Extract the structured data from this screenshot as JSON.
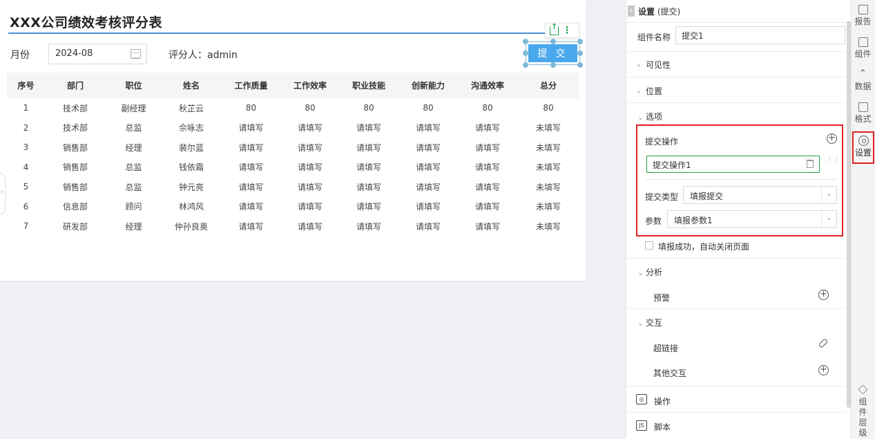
{
  "report": {
    "title": "XXX公司绩效考核评分表",
    "month_label": "月份",
    "month_value": "2024-08",
    "rater_text": "评分人：admin",
    "submit_label": "提 交",
    "columns": [
      "序号",
      "部门",
      "职位",
      "姓名",
      "工作质量",
      "工作效率",
      "职业技能",
      "创新能力",
      "沟通效率",
      "总分"
    ],
    "rows": [
      [
        "1",
        "技术部",
        "副经理",
        "秋芷云",
        "80",
        "80",
        "80",
        "80",
        "80",
        "80"
      ],
      [
        "2",
        "技术部",
        "总监",
        "佘咏志",
        "请填写",
        "请填写",
        "请填写",
        "请填写",
        "请填写",
        "未填写"
      ],
      [
        "3",
        "销售部",
        "经理",
        "裴尔蓝",
        "请填写",
        "请填写",
        "请填写",
        "请填写",
        "请填写",
        "未填写"
      ],
      [
        "4",
        "销售部",
        "总监",
        "钱依霜",
        "请填写",
        "请填写",
        "请填写",
        "请填写",
        "请填写",
        "未填写"
      ],
      [
        "5",
        "销售部",
        "总监",
        "钟元亮",
        "请填写",
        "请填写",
        "请填写",
        "请填写",
        "请填写",
        "未填写"
      ],
      [
        "6",
        "信息部",
        "顾问",
        "林鸿风",
        "请填写",
        "请填写",
        "请填写",
        "请填写",
        "请填写",
        "未填写"
      ],
      [
        "7",
        "研发部",
        "经理",
        "仲孙良奥",
        "请填写",
        "请填写",
        "请填写",
        "请填写",
        "请填写",
        "未填写"
      ]
    ]
  },
  "panel": {
    "header_bold": "设置",
    "header_rest": " (提交)",
    "component_name_label": "组件名称",
    "component_name_value": "提交1",
    "sections": {
      "visibility": "可见性",
      "position": "位置",
      "options": "选项",
      "analysis": "分析",
      "interaction": "交互"
    },
    "submit_ops_label": "提交操作",
    "op_item": "提交操作1",
    "submit_type_label": "提交类型",
    "submit_type_value": "填报提交",
    "param_label": "参数",
    "param_value": "填报参数1",
    "auto_close_label": "填报成功，自动关闭页面",
    "alert_label": "预警",
    "hyperlink_label": "超链接",
    "other_interaction_label": "其他交互",
    "operation_label": "操作",
    "script_label": "脚本",
    "script_icon_text": "JS"
  },
  "side_tabs": {
    "report": "报告",
    "component": "组件",
    "data": "数据",
    "format": "格式",
    "settings": "设置",
    "layers": [
      "组",
      "件",
      "层",
      "级"
    ]
  },
  "colors": {
    "accent_blue": "#4aa8ec",
    "title_line": "#4a90d9",
    "highlight_red": "#e02020",
    "selected_green": "#2ba24c"
  }
}
